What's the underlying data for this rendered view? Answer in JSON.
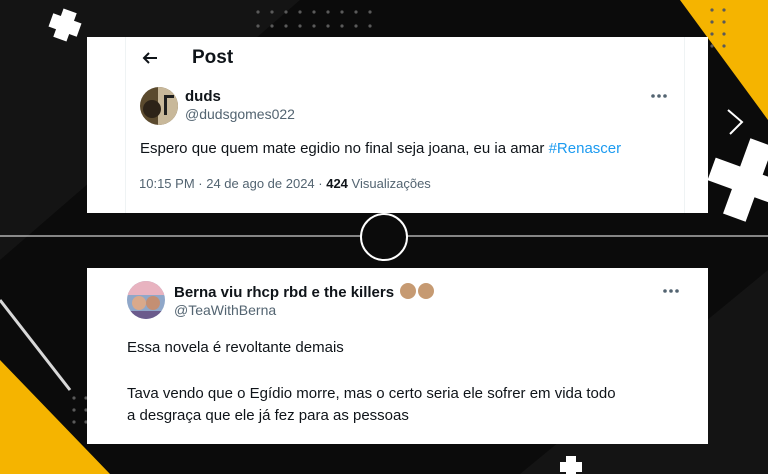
{
  "tweet1": {
    "header_title": "Post",
    "name": "duds",
    "handle": "@dudsgomes022",
    "text": "Espero que quem mate egidio no final seja joana, eu ia amar",
    "hashtag": "#Renascer",
    "time": "10:15 PM",
    "date": "24 de ago de 2024",
    "views": "424",
    "views_label": "Visualizações",
    "icons": {
      "back": "arrow-left-icon",
      "more": "more-horizontal-icon"
    }
  },
  "tweet2": {
    "name": "Berna viu rhcp rbd e the killers",
    "handle": "@TeaWithBerna",
    "line1": "Essa novela é revoltante demais",
    "line2": "Tava vendo que o Egídio morre, mas o certo seria ele sofrer em vida todo",
    "line3": "a desgraça que ele já fez para as pessoas",
    "icons": {
      "more": "more-horizontal-icon",
      "emoji": "clapping-hands-icon"
    }
  },
  "colors": {
    "accent": "#1d9bf0",
    "yellow": "#f5b400",
    "background": "#0b0b0b"
  }
}
